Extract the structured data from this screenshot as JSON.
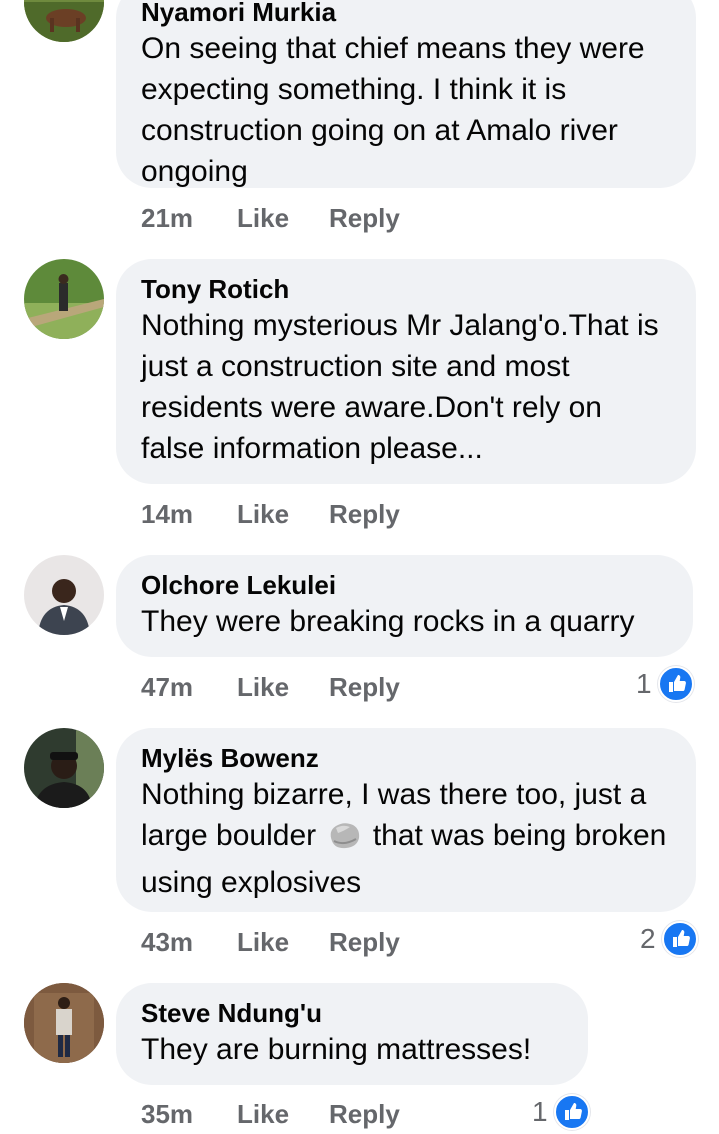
{
  "comments": [
    {
      "name": "Nyamori Murkia",
      "text": "On seeing that chief means they were expecting something. I think it is construction going on at Amalo river ongoing",
      "time": "21m",
      "like": "Like",
      "reply": "Reply"
    },
    {
      "name": "Tony Rotich",
      "text": "Nothing mysterious Mr Jalang'o.That is just a construction site and most residents were aware.Don't rely on false information please...",
      "time": "14m",
      "like": "Like",
      "reply": "Reply"
    },
    {
      "name": "Olchore Lekulei",
      "text": "They were breaking rocks in a quarry",
      "time": "47m",
      "like": "Like",
      "reply": "Reply",
      "reactions": "1"
    },
    {
      "name": "Mylës Bowenz",
      "text_before": "Nothing bizarre, I was there too, just a large boulder",
      "text_after": "that was being broken using explosives",
      "emoji": "rock-emoji",
      "time": "43m",
      "like": "Like",
      "reply": "Reply",
      "reactions": "2"
    },
    {
      "name": "Steve Ndung'u",
      "text": "They are burning mattresses!",
      "time": "35m",
      "like": "Like",
      "reply": "Reply",
      "reactions": "1"
    }
  ],
  "colors": {
    "bubble": "#f0f2f5",
    "meta_text": "#65676b",
    "like_blue": "#1877f2"
  }
}
